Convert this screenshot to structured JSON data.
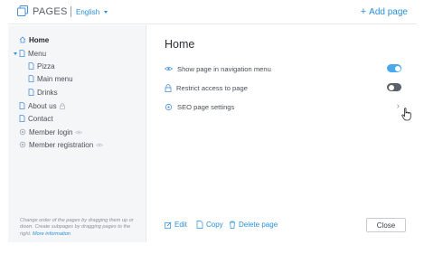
{
  "header": {
    "title": "PAGES",
    "language": "English",
    "add_page_label": "Add page"
  },
  "sidebar": {
    "items": [
      {
        "label": "Home",
        "icon": "home-icon",
        "active": true
      },
      {
        "label": "Menu",
        "icon": "page-icon",
        "expanded": true
      },
      {
        "label": "Pizza",
        "icon": "page-icon"
      },
      {
        "label": "Main menu",
        "icon": "page-icon"
      },
      {
        "label": "Drinks",
        "icon": "page-icon"
      },
      {
        "label": "About us",
        "icon": "page-icon",
        "suffix_icon": "lock-icon"
      },
      {
        "label": "Contact",
        "icon": "page-icon"
      },
      {
        "label": "Member login",
        "icon": "gear-icon",
        "suffix_icon": "eye-icon"
      },
      {
        "label": "Member registration",
        "icon": "gear-icon",
        "suffix_icon": "eye-icon"
      }
    ],
    "help_text": "Change order of the pages by dragging them up or down. Create subpages by dragging pages to the right.",
    "help_link": "More information"
  },
  "main": {
    "title": "Home",
    "settings": [
      {
        "label": "Show page in navigation menu",
        "icon": "eye-icon",
        "control": "toggle",
        "on": true
      },
      {
        "label": "Restrict access to page",
        "icon": "lock-icon",
        "control": "toggle",
        "on": false
      },
      {
        "label": "SEO page settings",
        "icon": "gear-icon",
        "control": "chevron"
      }
    ],
    "seo_chevron": "›",
    "footer": {
      "edit_label": "Edit",
      "copy_label": "Copy",
      "delete_label": "Delete page",
      "close_label": "Close"
    }
  },
  "colors": {
    "accent": "#2a8fd8",
    "toggle_on": "#4aa8ec",
    "toggle_off": "#5b6168",
    "sidebar_bg": "#f5f6f7"
  }
}
